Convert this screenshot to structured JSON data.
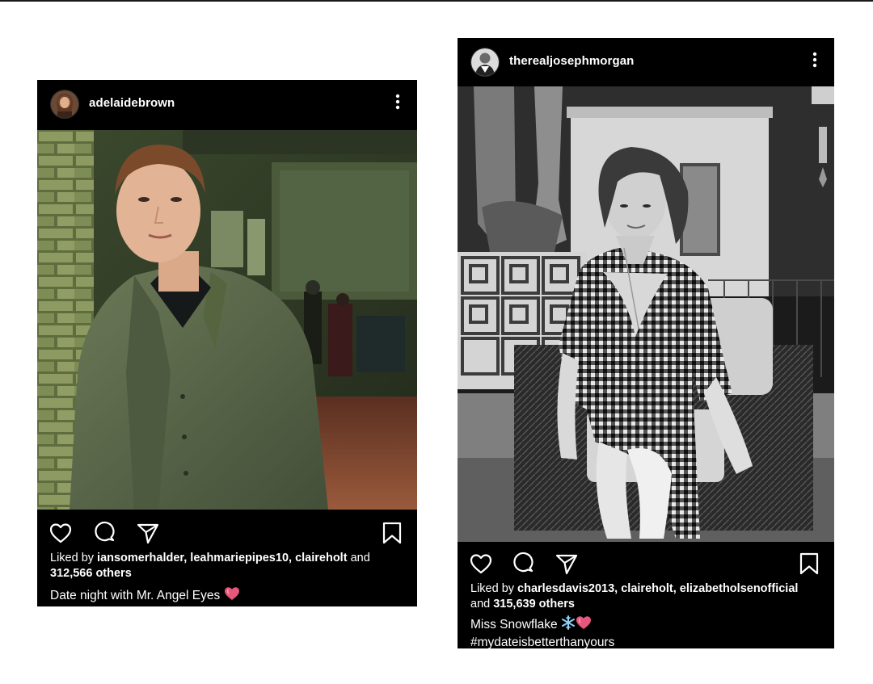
{
  "posts": [
    {
      "username": "adelaidebrown",
      "icons": [
        "heart-icon",
        "comment-icon",
        "share-icon",
        "bookmark-icon",
        "more-vertical-icon"
      ],
      "likes_prefix": "Liked by ",
      "liked_users": [
        "iansomerhalder",
        "leahmariepipes10",
        "claireholt"
      ],
      "likes_and": " and ",
      "likes_count": "312,566 others",
      "caption": "Date night with Mr. Angel Eyes",
      "caption_emoji": [
        "heart-emoji"
      ]
    },
    {
      "username": "therealjosephmorgan",
      "icons": [
        "heart-icon",
        "comment-icon",
        "share-icon",
        "bookmark-icon",
        "more-vertical-icon"
      ],
      "likes_prefix": "Liked by ",
      "liked_users": [
        "charlesdavis2013",
        "claireholt",
        "elizabetholsenofficial"
      ],
      "likes_and": "and ",
      "likes_count": "315,639 others",
      "caption": "Miss Snowflake",
      "caption_emoji": [
        "snowflake-emoji",
        "heart-emoji"
      ],
      "hashtag": "#mydateisbetterthanyours"
    }
  ],
  "colors": {
    "post_bg": "#000000",
    "page_bg": "#ffffff",
    "text": "#ffffff",
    "heart_emoji": "#e8567a",
    "snowflake_emoji": "#8fd0f5"
  }
}
